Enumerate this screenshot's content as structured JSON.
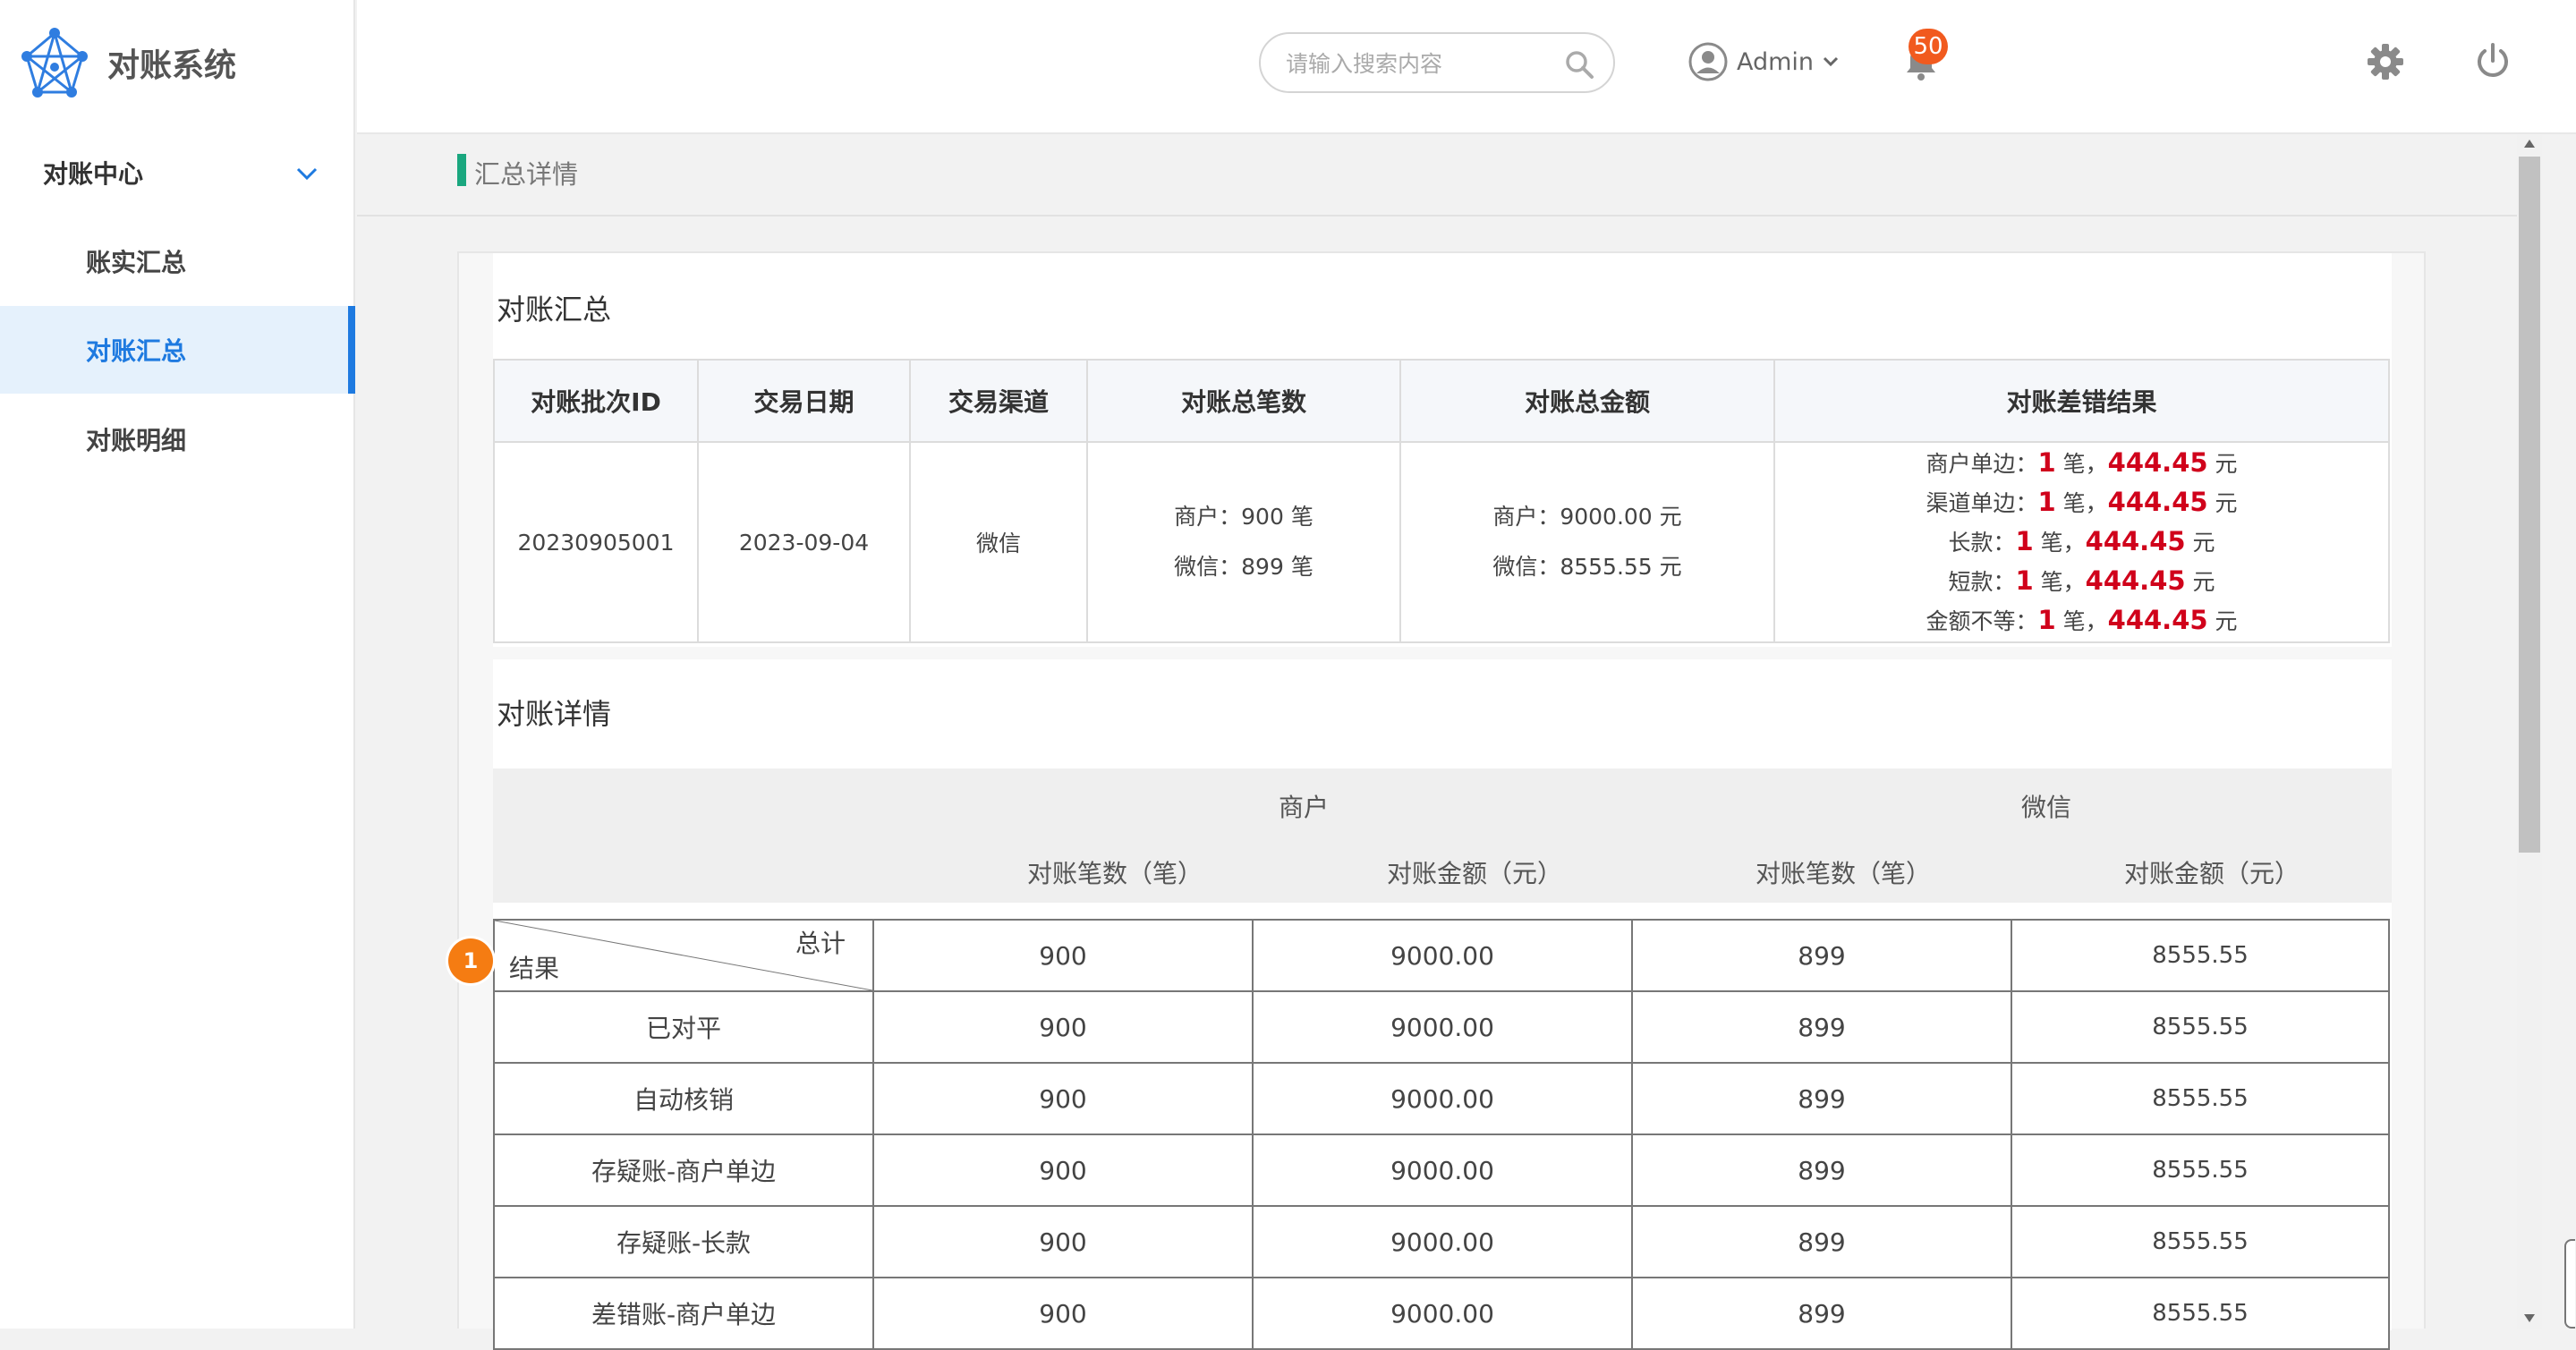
{
  "app": {
    "name": "对账系统"
  },
  "sidebar": {
    "group": {
      "label": "对账中心"
    },
    "items": [
      {
        "label": "账实汇总"
      },
      {
        "label": "对账汇总"
      },
      {
        "label": "对账明细"
      }
    ]
  },
  "header": {
    "search_placeholder": "请输入搜索内容",
    "user": "Admin",
    "notification_count": "50"
  },
  "page": {
    "title": "汇总详情"
  },
  "summary": {
    "title": "对账汇总",
    "columns": [
      "对账批次ID",
      "交易日期",
      "交易渠道",
      "对账总笔数",
      "对账总金额",
      "对账差错结果"
    ],
    "row": {
      "batch_id": "20230905001",
      "date": "2023-09-04",
      "channel": "微信",
      "count_merchant": "商户：900 笔",
      "count_wechat": "微信：899 笔",
      "amount_merchant": "商户：9000.00 元",
      "amount_wechat": "微信：8555.55 元",
      "diffs": [
        {
          "label": "商户单边：",
          "count": "1",
          "unit": " 笔，",
          "amount": "444.45",
          "suffix": " 元"
        },
        {
          "label": "渠道单边：",
          "count": "1",
          "unit": " 笔，",
          "amount": "444.45",
          "suffix": " 元"
        },
        {
          "label": "长款：",
          "count": "1",
          "unit": " 笔，",
          "amount": "444.45",
          "suffix": " 元"
        },
        {
          "label": "短款：",
          "count": "1",
          "unit": " 笔，",
          "amount": "444.45",
          "suffix": " 元"
        },
        {
          "label": "金额不等：",
          "count": "1",
          "unit": " 笔，",
          "amount": "444.45",
          "suffix": " 元"
        }
      ]
    }
  },
  "detail": {
    "title": "对账详情",
    "group_headers": [
      "商户",
      "微信"
    ],
    "sub_headers": [
      "对账笔数（笔）",
      "对账金额（元）",
      "对账笔数（笔）",
      "对账金额（元）"
    ],
    "corner_top": "总计",
    "corner_bottom": "结果",
    "marker": "1",
    "total_row": [
      "900",
      "9000.00",
      "899",
      "8555.55"
    ],
    "rows": [
      {
        "label": "已对平",
        "values": [
          "900",
          "9000.00",
          "899",
          "8555.55"
        ]
      },
      {
        "label": "自动核销",
        "values": [
          "900",
          "9000.00",
          "899",
          "8555.55"
        ]
      },
      {
        "label": "存疑账-商户单边",
        "values": [
          "900",
          "9000.00",
          "899",
          "8555.55"
        ]
      },
      {
        "label": "存疑账-长款",
        "values": [
          "900",
          "9000.00",
          "899",
          "8555.55"
        ]
      },
      {
        "label": "差错账-商户单边",
        "values": [
          "900",
          "9000.00",
          "899",
          "8555.55"
        ]
      }
    ]
  }
}
